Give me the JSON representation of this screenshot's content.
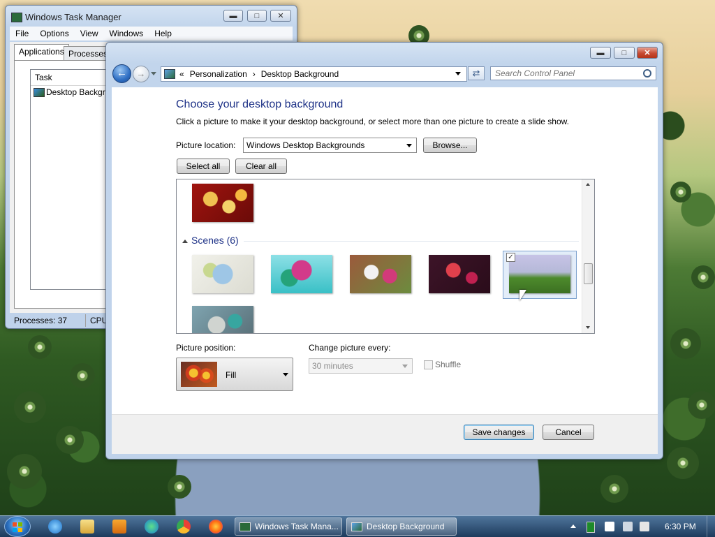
{
  "taskmgr": {
    "title": "Windows Task Manager",
    "menu": [
      "File",
      "Options",
      "View",
      "Windows",
      "Help"
    ],
    "tabs": {
      "applications": "Applications",
      "processes": "Processes"
    },
    "list_header": "Task",
    "task_row": "Desktop Backgroun",
    "status": {
      "processes": "Processes: 37",
      "cpu": "CPU U"
    }
  },
  "controlpanel": {
    "breadcrumb": {
      "prefix": "«",
      "personalization": "Personalization",
      "sep": "›",
      "current": "Desktop Background"
    },
    "search_placeholder": "Search Control Panel",
    "heading": "Choose your desktop background",
    "description": "Click a picture to make it your desktop background, or select more than one picture to create a slide show.",
    "picture_location_label": "Picture location:",
    "picture_location_value": "Windows Desktop Backgrounds",
    "browse_label": "Browse...",
    "select_all_label": "Select all",
    "clear_all_label": "Clear all",
    "group_label": "Scenes (6)",
    "picture_position_label": "Picture position:",
    "picture_position_value": "Fill",
    "change_every_label": "Change picture every:",
    "change_every_value": "30 minutes",
    "shuffle_label": "Shuffle",
    "save_label": "Save changes",
    "cancel_label": "Cancel"
  },
  "taskbar": {
    "tasks": [
      "Windows Task Mana...",
      "Desktop Background"
    ],
    "clock": "6:30 PM"
  }
}
